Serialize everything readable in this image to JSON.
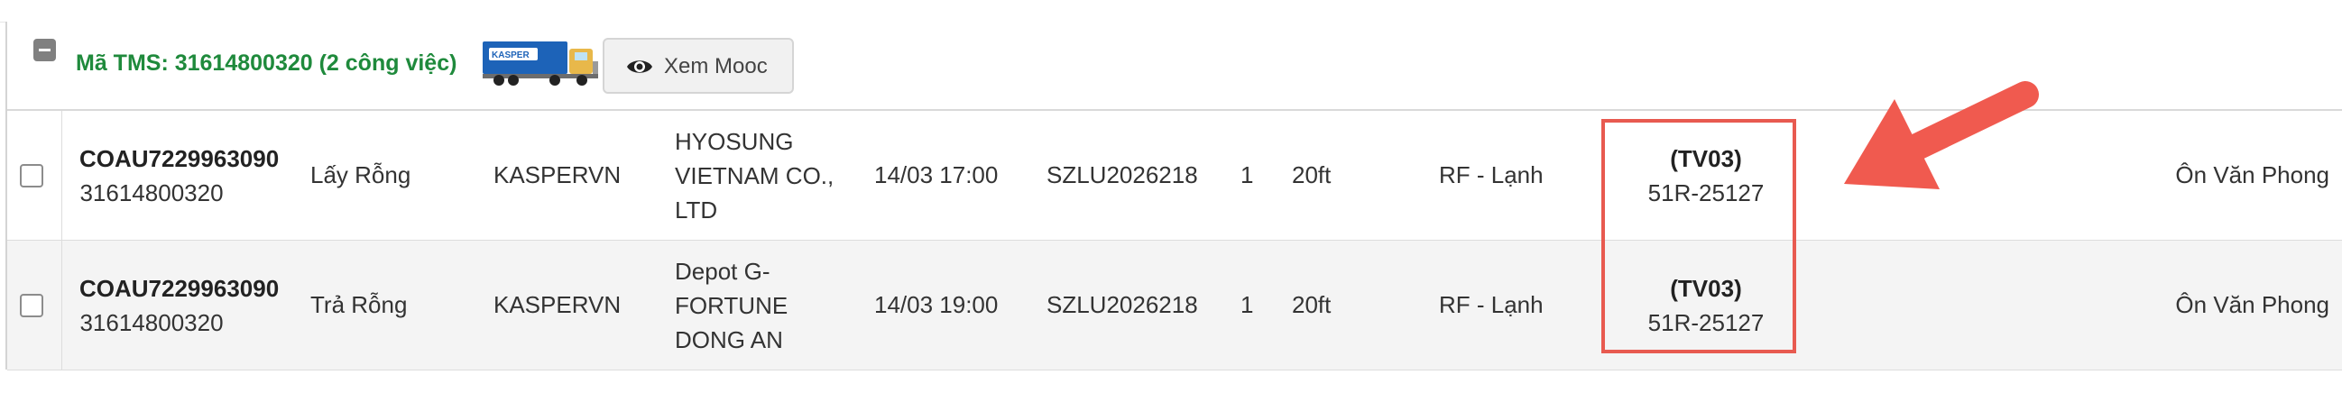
{
  "group": {
    "tms_label": "Mã TMS: 31614800320 (2 công việc)",
    "truck_brand": "KASPER",
    "view_button_label": "Xem Mooc"
  },
  "colors": {
    "tms_label": "#1f8a3c",
    "highlight": "#e85a50",
    "arrow": "#f05a4f",
    "truck_blue": "#1d63b8"
  },
  "icons": {
    "collapse": "minus-square-icon",
    "truck": "truck-icon",
    "view": "eye-icon"
  },
  "rows": [
    {
      "container_code": "COAU7229963090",
      "tms_code": "31614800320",
      "task": "Lấy Rỗng",
      "customer": "KASPERVN",
      "location_lines": [
        "HYOSUNG",
        "VIETNAM CO.,",
        "LTD"
      ],
      "time": "14/03 17:00",
      "seal": "SZLU2026218",
      "quantity": "1",
      "size": "20ft",
      "type": "RF - Lạnh",
      "vehicle_code": "(TV03)",
      "plate": "51R-25127",
      "driver": "Ôn Văn Phong"
    },
    {
      "container_code": "COAU7229963090",
      "tms_code": "31614800320",
      "task": "Trả Rỗng",
      "customer": "KASPERVN",
      "location_lines": [
        "Depot G-",
        "FORTUNE",
        "DONG AN"
      ],
      "time": "14/03 19:00",
      "seal": "SZLU2026218",
      "quantity": "1",
      "size": "20ft",
      "type": "RF - Lạnh",
      "vehicle_code": "(TV03)",
      "plate": "51R-25127",
      "driver": "Ôn Văn Phong"
    }
  ]
}
